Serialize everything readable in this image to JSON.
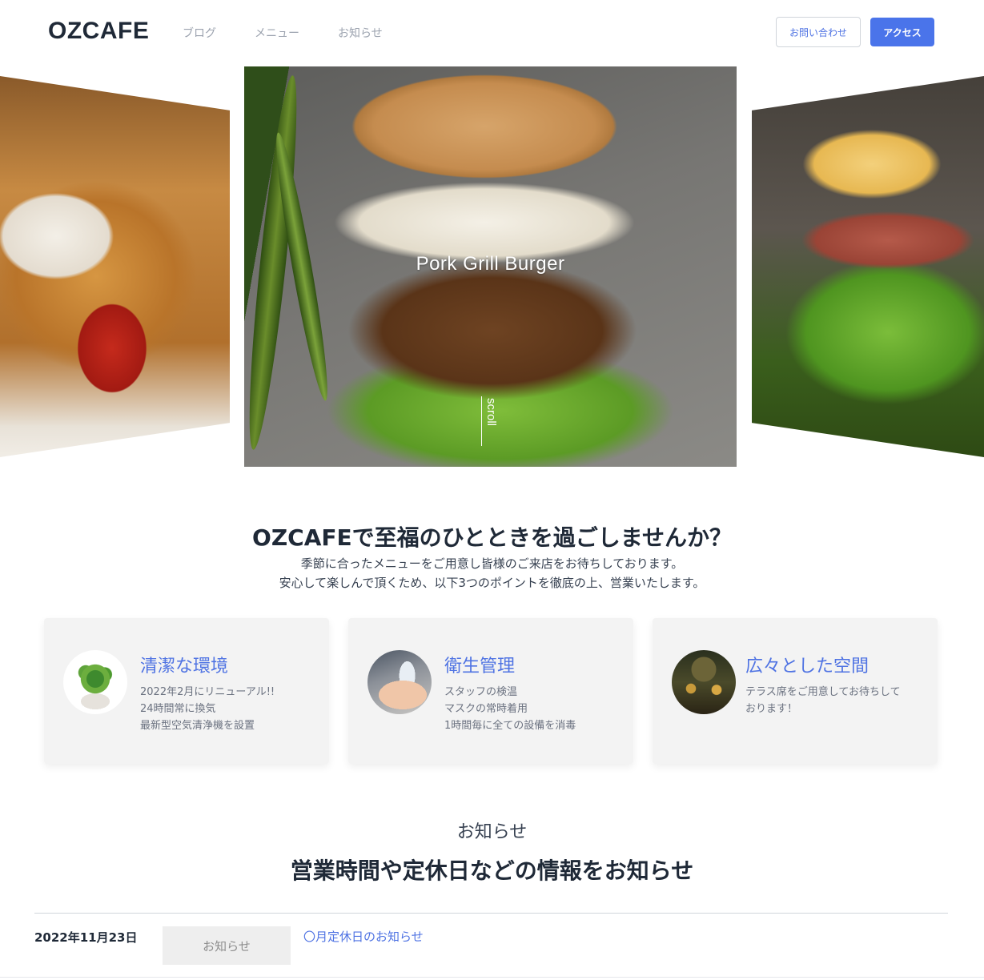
{
  "header": {
    "logo": "OZCAFE",
    "nav": [
      "ブログ",
      "メニュー",
      "お知らせ"
    ],
    "contact_label": "お問い合わせ",
    "access_label": "アクセス"
  },
  "hero": {
    "slide_title": "Pork Grill Burger",
    "scroll_label": "scroll"
  },
  "intro": {
    "title": "OZCAFEで至福のひとときを過ごしませんか？",
    "lines": [
      "季節に合ったメニューをご用意し皆様のご来店をお待ちしております。",
      "安心して楽しんで頂くため、以下3つのポイントを徹底の上、営業いたします。"
    ]
  },
  "cards": [
    {
      "title": "清潔な環境",
      "icon": "plant-photo",
      "lines": [
        "2022年2月にリニューアル!!",
        "24時間常に換気",
        "最新型空気清浄機を設置"
      ]
    },
    {
      "title": "衛生管理",
      "icon": "hand-sanitizer-photo",
      "lines": [
        "スタッフの検温",
        "マスクの常時着用",
        "1時間毎に全ての設備を消毒"
      ]
    },
    {
      "title": "広々とした空間",
      "icon": "terrace-photo",
      "lines": [
        "テラス席をご用意してお待ちして",
        "おります！"
      ]
    }
  ],
  "news": {
    "label": "お知らせ",
    "heading": "営業時間や定休日などの情報をお知らせ",
    "items": [
      {
        "date": "2022年11月23日",
        "category": "お知らせ",
        "title": "〇月定休日のお知らせ"
      }
    ]
  },
  "colors": {
    "accent": "#4a74ea",
    "link": "#4f73e3",
    "card_bg": "#f3f3f3"
  }
}
